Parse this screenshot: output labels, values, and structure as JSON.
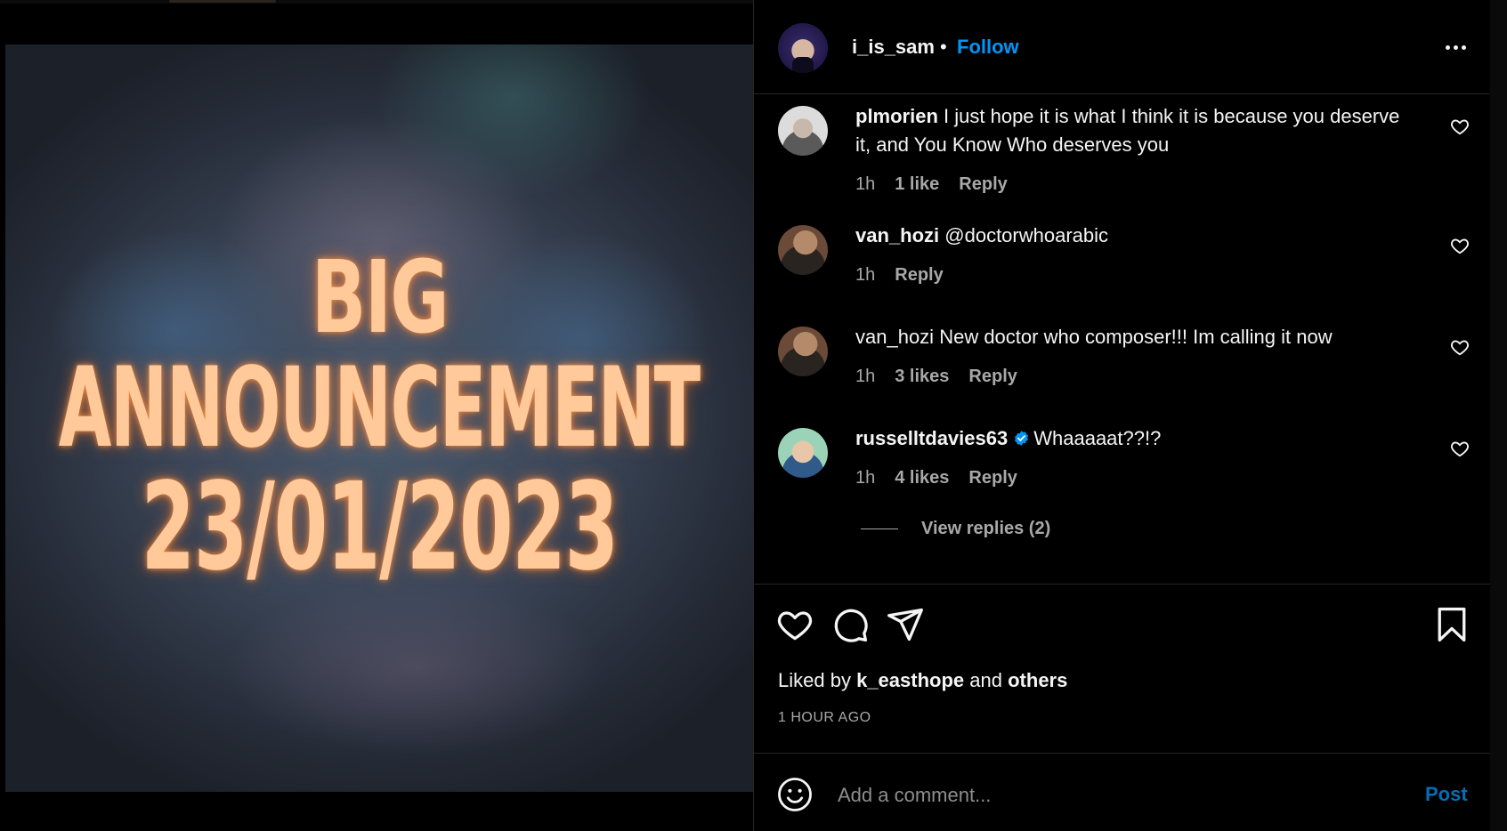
{
  "media": {
    "line1": "BIG",
    "line2": "ANNOUNCEMENT",
    "line3": "23/01/2023"
  },
  "header": {
    "username": "i_is_sam",
    "separator": "•",
    "follow_label": "Follow",
    "more_icon": "more-horizontal-icon"
  },
  "comments": [
    {
      "user": "plmorien",
      "text": "I just hope it is what I think it is because you deserve it, and You Know Who deserves you",
      "time": "1h",
      "likes": "1 like",
      "reply": "Reply"
    },
    {
      "user": "van_hozi",
      "text": "@doctorwhoarabic",
      "time": "1h",
      "likes": "",
      "reply": "Reply"
    },
    {
      "user": "van_hozi",
      "text": "New doctor who composer!!! Im calling it now",
      "time": "1h",
      "likes": "3 likes",
      "reply": "Reply"
    },
    {
      "user": "russelltdavies63",
      "verified": true,
      "text": "Whaaaaat??!?",
      "time": "1h",
      "likes": "4 likes",
      "reply": "Reply"
    }
  ],
  "view_replies": "View replies (2)",
  "actions": {
    "icons": [
      "heart-icon",
      "comment-icon",
      "share-icon",
      "bookmark-icon"
    ]
  },
  "liked_by": {
    "prefix": "Liked by",
    "user": "k_easthope",
    "middle": "and",
    "others": "others"
  },
  "time_ago": "1 HOUR AGO",
  "add_comment": {
    "placeholder": "Add a comment...",
    "post_label": "Post"
  },
  "colors": {
    "accent": "#0095f6",
    "glow_text": "#ffc99a",
    "muted": "#a8a8a8"
  }
}
